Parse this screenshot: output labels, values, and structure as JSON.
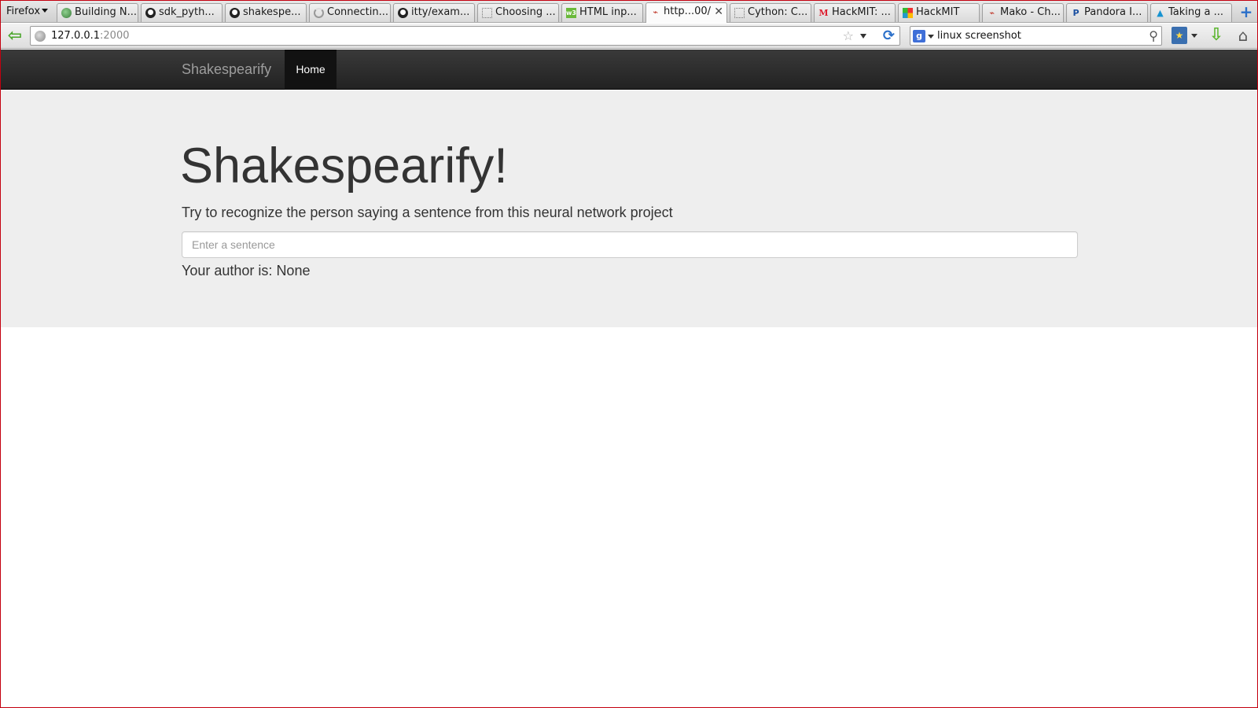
{
  "browser": {
    "menu_label": "Firefox",
    "tabs": [
      {
        "label": "Building N...",
        "icon": "globe-icon"
      },
      {
        "label": "sdk_pyth...",
        "icon": "github-icon"
      },
      {
        "label": "shakespe...",
        "icon": "github-icon"
      },
      {
        "label": "Connectin...",
        "icon": "loading-icon"
      },
      {
        "label": "itty/exam...",
        "icon": "github-icon"
      },
      {
        "label": "Choosing ...",
        "icon": "blank-page-icon"
      },
      {
        "label": "HTML inp...",
        "icon": "w3schools-icon"
      },
      {
        "label": "http...00/",
        "icon": "python-icon",
        "active": true
      },
      {
        "label": "Cython: C...",
        "icon": "blank-page-icon"
      },
      {
        "label": "HackMIT: ...",
        "icon": "gmail-icon"
      },
      {
        "label": "HackMIT",
        "icon": "hackmit-icon"
      },
      {
        "label": "Mako - Ch...",
        "icon": "python-icon"
      },
      {
        "label": "Pandora I...",
        "icon": "pandora-icon"
      },
      {
        "label": "Taking a ...",
        "icon": "arch-icon"
      }
    ],
    "url_host": "127.0.0.1",
    "url_port": ":2000",
    "search_value": "linux screenshot",
    "search_engine_letter": "g",
    "colors": {
      "frame_border": "#c4000f",
      "back_arrow": "#4aa52a",
      "download_arrow": "#5bb52e"
    }
  },
  "page": {
    "navbar": {
      "brand": "Shakespearify",
      "home": "Home"
    },
    "jumbotron": {
      "title": "Shakespearify!",
      "lead": "Try to recognize the person saying a sentence from this neural network project",
      "input_placeholder": "Enter a sentence",
      "result_label": "Your author is:",
      "result_value": "None"
    },
    "colors": {
      "navbar_bg": "#222222",
      "jumbotron_bg": "#eeeeee",
      "text": "#333333"
    }
  }
}
